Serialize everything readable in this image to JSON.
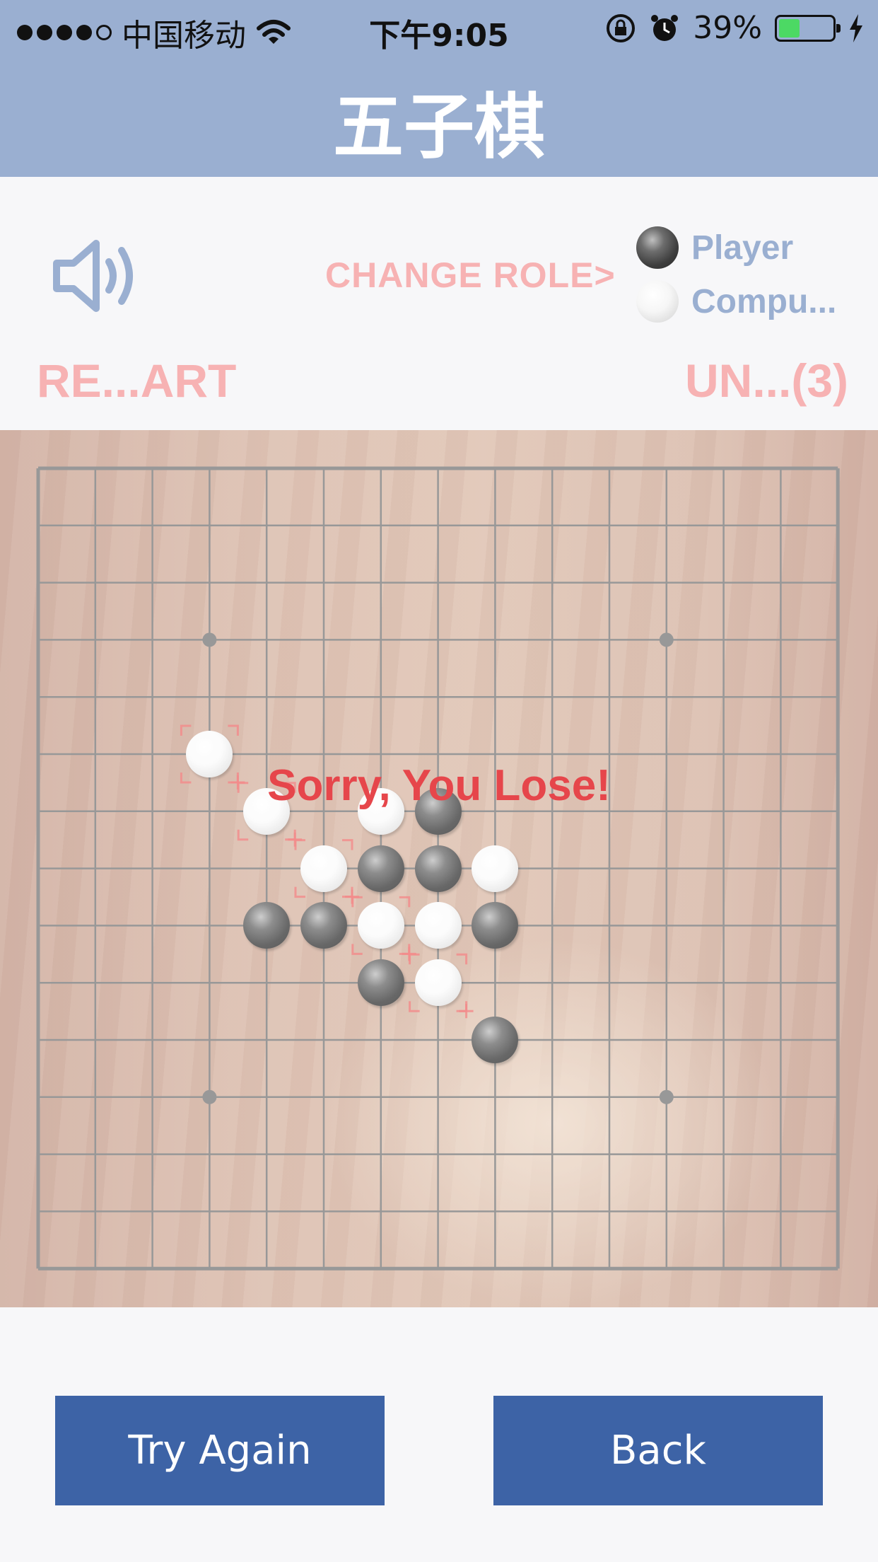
{
  "status_bar": {
    "carrier": "中国移动",
    "time": "下午9:05",
    "battery": "39%",
    "battery_level": 0.39,
    "signal_bars": 4,
    "icons": [
      "signal-dots-icon",
      "wifi-icon",
      "rotation-lock-icon",
      "alarm-icon",
      "battery-icon",
      "charging-icon"
    ]
  },
  "nav": {
    "title": "五子棋"
  },
  "controls": {
    "sound_icon": "speaker-icon",
    "change_role": "CHANGE ROLE>",
    "roles": [
      {
        "stone": "black",
        "label": "Player"
      },
      {
        "stone": "white",
        "label": "Compu..."
      }
    ],
    "restart": "RE...ART",
    "undo": "UN...(3)"
  },
  "board": {
    "size": 15,
    "star_points": [
      [
        3,
        3
      ],
      [
        11,
        3
      ],
      [
        3,
        11
      ],
      [
        11,
        11
      ]
    ],
    "stones": [
      {
        "color": "white",
        "col": 3,
        "row": 5
      },
      {
        "color": "white",
        "col": 4,
        "row": 6
      },
      {
        "color": "white",
        "col": 6,
        "row": 6
      },
      {
        "color": "black",
        "col": 7,
        "row": 6
      },
      {
        "color": "white",
        "col": 5,
        "row": 7
      },
      {
        "color": "black",
        "col": 6,
        "row": 7
      },
      {
        "color": "black",
        "col": 7,
        "row": 7
      },
      {
        "color": "white",
        "col": 8,
        "row": 7
      },
      {
        "color": "black",
        "col": 4,
        "row": 8
      },
      {
        "color": "black",
        "col": 5,
        "row": 8
      },
      {
        "color": "white",
        "col": 6,
        "row": 8
      },
      {
        "color": "white",
        "col": 7,
        "row": 8
      },
      {
        "color": "black",
        "col": 8,
        "row": 8
      },
      {
        "color": "black",
        "col": 6,
        "row": 9
      },
      {
        "color": "white",
        "col": 7,
        "row": 9
      },
      {
        "color": "black",
        "col": 8,
        "row": 10
      }
    ],
    "winning_line": [
      [
        3,
        5
      ],
      [
        4,
        6
      ],
      [
        5,
        7
      ],
      [
        6,
        8
      ],
      [
        7,
        9
      ]
    ],
    "result": "Sorry, You Lose!",
    "colors": {
      "line": "#7b7b7b",
      "highlight": "#f06a6a",
      "result": "#e6464b"
    }
  },
  "buttons": {
    "try_again": "Try Again",
    "back": "Back"
  },
  "colors": {
    "nav_bg": "#9aafd1",
    "button_bg": "#3d63a6",
    "faded_red": "#f7b2b3",
    "role_blue": "#9aafd1"
  }
}
